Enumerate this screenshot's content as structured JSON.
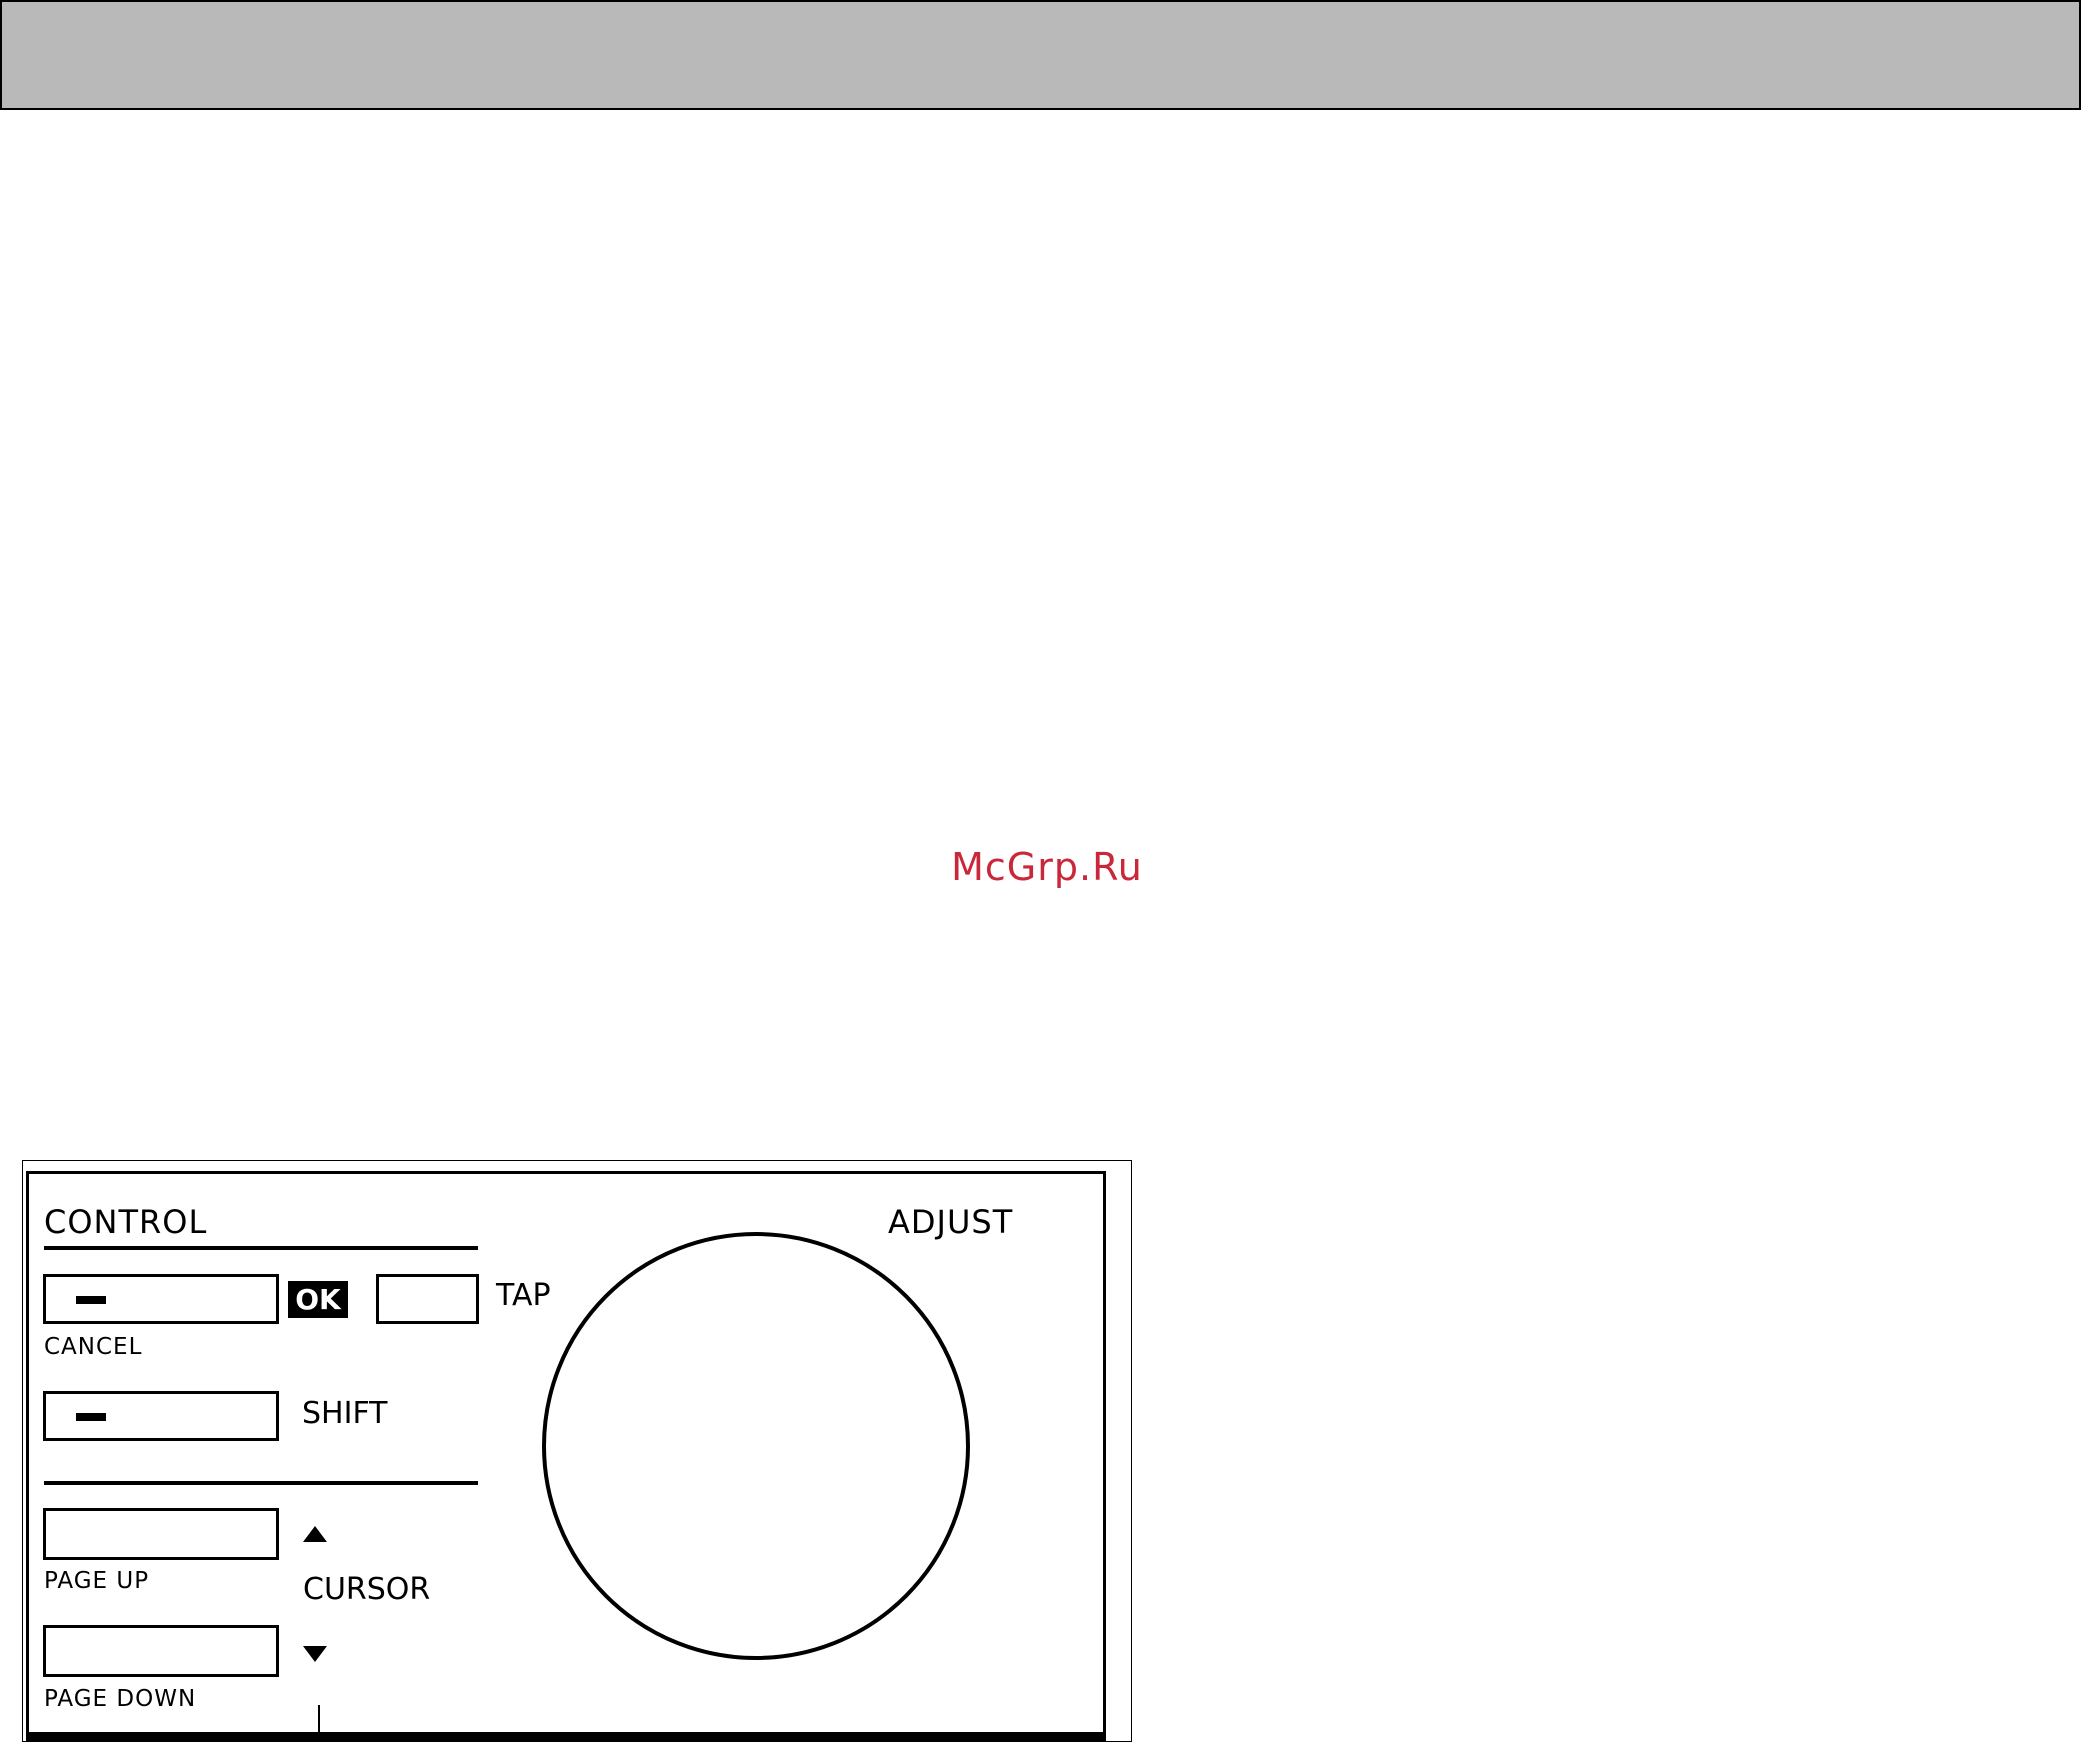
{
  "watermark": "McGrp.Ru",
  "panel": {
    "control_heading": "CONTROL",
    "adjust_heading": "ADJUST",
    "ok_label": "OK",
    "tap_label": "TAP",
    "cancel_label": "CANCEL",
    "shift_label": "SHIFT",
    "page_up_label": "PAGE UP",
    "page_down_label": "PAGE DOWN",
    "cursor_label": "CURSOR"
  },
  "colors": {
    "header_bar": "#b9b9b9",
    "watermark": "#c8283a"
  }
}
